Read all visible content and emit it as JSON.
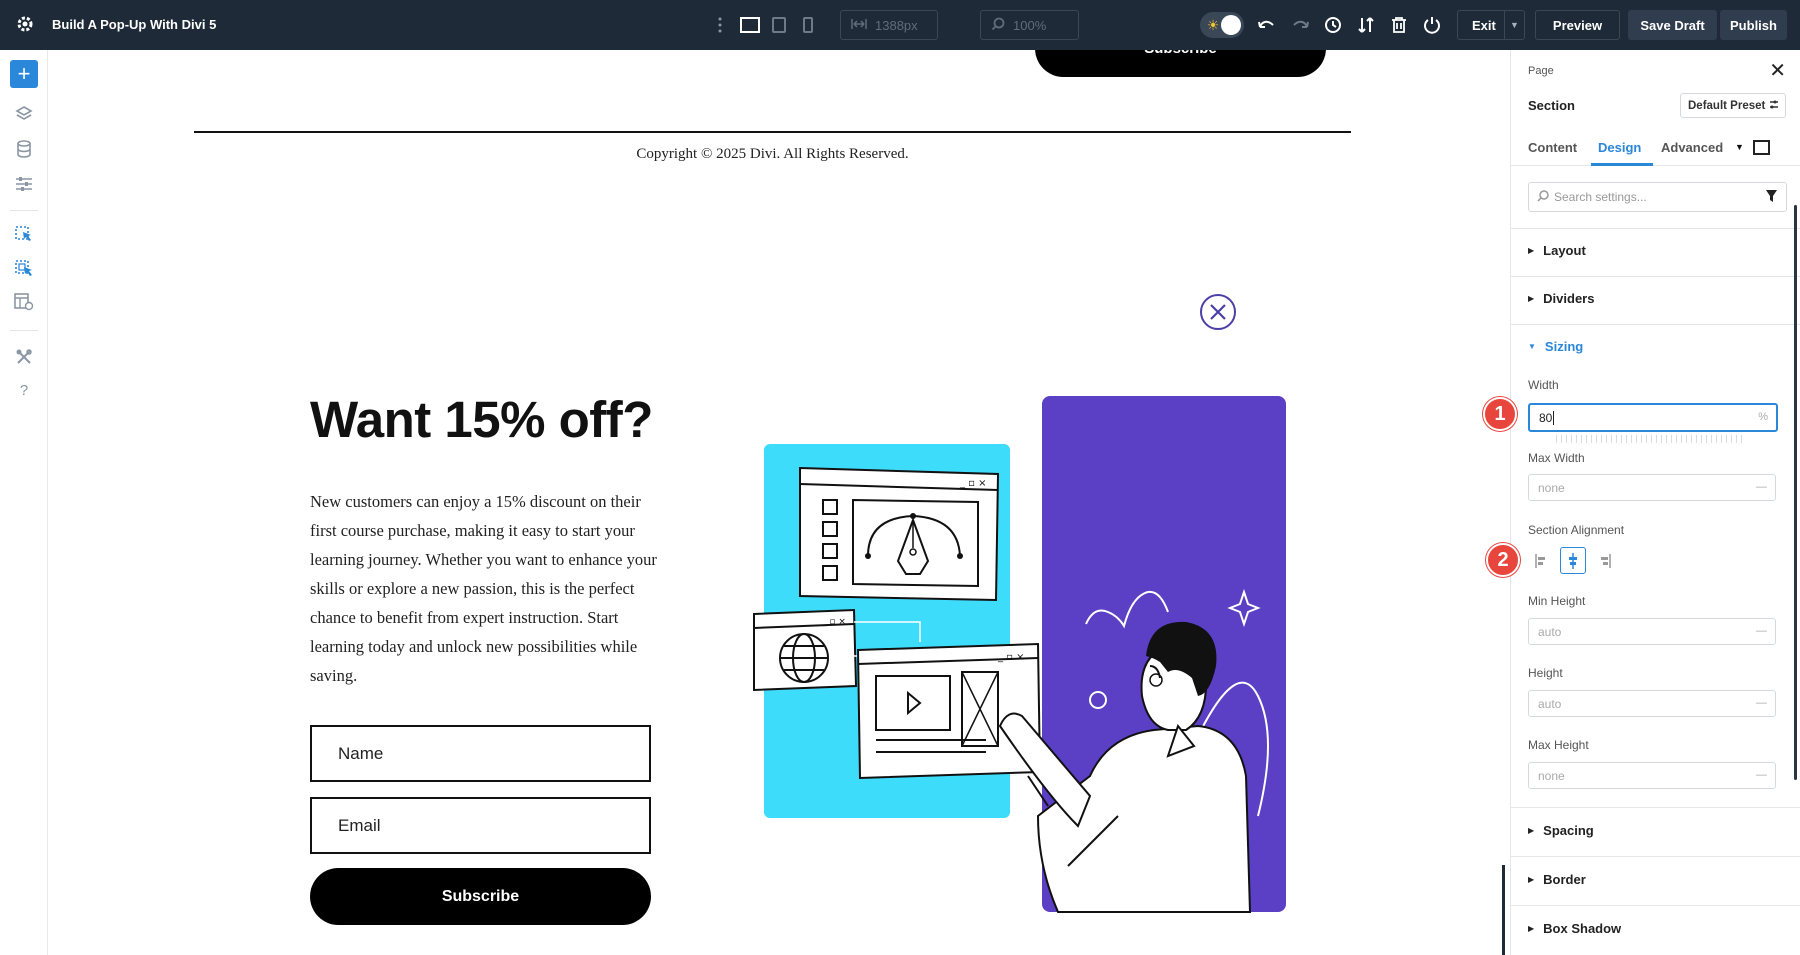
{
  "app": {
    "title": "Build A Pop-Up With Divi 5"
  },
  "toolbar": {
    "width_value": "1388px",
    "zoom_value": "100%",
    "exit_label": "Exit",
    "preview_label": "Preview",
    "save_draft_label": "Save Draft",
    "publish_label": "Publish"
  },
  "canvas": {
    "top_subscribe_label": "Subscribe",
    "copyright": "Copyright © 2025 Divi. All Rights Reserved.",
    "popup": {
      "headline": "Want 15% off?",
      "body": "New customers can enjoy a 15% discount on their first course purchase, making it easy to start your learning journey. Whether you want to enhance your skills or explore a new passion, this is the perfect chance to benefit from expert instruction. Start learning today and unlock new possibilities while saving.",
      "name_placeholder": "Name",
      "email_placeholder": "Email",
      "subscribe_label": "Subscribe"
    }
  },
  "panel": {
    "breadcrumb": "Page",
    "element": "Section",
    "preset": "Default Preset",
    "tabs": [
      "Content",
      "Design",
      "Advanced"
    ],
    "active_tab": "Design",
    "search_placeholder": "Search settings...",
    "groups": {
      "layout": "Layout",
      "dividers": "Dividers",
      "sizing": "Sizing",
      "spacing": "Spacing",
      "border": "Border",
      "box_shadow": "Box Shadow"
    },
    "fields": {
      "width_label": "Width",
      "width_value": "80",
      "width_unit": "%",
      "max_width_label": "Max Width",
      "max_width_value": "none",
      "section_alignment_label": "Section Alignment",
      "min_height_label": "Min Height",
      "min_height_value": "auto",
      "height_label": "Height",
      "height_value": "auto",
      "max_height_label": "Max Height",
      "max_height_value": "none",
      "unit_dash": "—"
    }
  },
  "annotations": [
    "1",
    "2"
  ],
  "colors": {
    "topbar_bg": "#1e2a38",
    "accent_blue": "#2b87da",
    "popup_purple": "#5b3fc4",
    "popup_cyan": "#3ddcfb",
    "badge_red": "#e8453c"
  },
  "icons": [
    "gear-icon",
    "layers-icon",
    "database-icon",
    "sliders-icon",
    "cursor-icon",
    "page-settings-icon",
    "tools-icon",
    "help-icon",
    "desktop-icon",
    "tablet-icon",
    "phone-icon",
    "undo-icon",
    "redo-icon",
    "history-icon",
    "sort-icon",
    "trash-icon",
    "power-icon",
    "close-icon"
  ]
}
